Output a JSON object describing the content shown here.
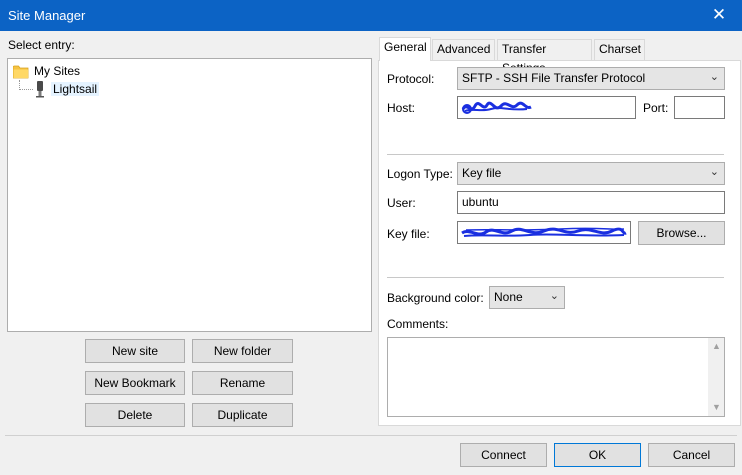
{
  "window": {
    "title": "Site Manager",
    "close_glyph": "✕"
  },
  "left": {
    "select_entry_label": "Select entry:",
    "tree": {
      "root": {
        "label": "My Sites",
        "icon": "folder-icon"
      },
      "child": {
        "label": "Lightsail",
        "icon": "server-icon"
      }
    },
    "buttons": {
      "new_site": "New site",
      "new_folder": "New folder",
      "new_bookmark": "New Bookmark",
      "rename": "Rename",
      "delete": "Delete",
      "duplicate": "Duplicate"
    }
  },
  "tabs": [
    "General",
    "Advanced",
    "Transfer Settings",
    "Charset"
  ],
  "general": {
    "protocol_label": "Protocol:",
    "protocol_value": "SFTP - SSH File Transfer Protocol",
    "host_label": "Host:",
    "port_label": "Port:",
    "port_value": "",
    "logon_type_label": "Logon Type:",
    "logon_type_value": "Key file",
    "user_label": "User:",
    "user_value": "ubuntu",
    "key_file_label": "Key file:",
    "browse_label": "Browse...",
    "background_color_label": "Background color:",
    "background_color_value": "None",
    "comments_label": "Comments:"
  },
  "footer": {
    "connect": "Connect",
    "ok": "OK",
    "cancel": "Cancel"
  },
  "colors": {
    "titlebar": "#0c63c5",
    "redaction": "#1a2fe0"
  }
}
